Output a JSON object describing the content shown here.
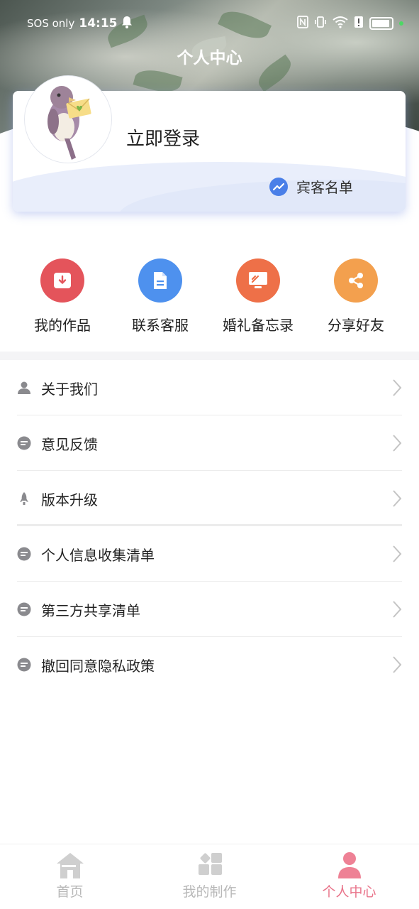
{
  "status_bar": {
    "carrier": "SOS only",
    "time": "14:15"
  },
  "header": {
    "title": "个人中心"
  },
  "profile": {
    "login_text": "立即登录",
    "guest_list_label": "宾客名单"
  },
  "quick_actions": [
    {
      "label": "我的作品",
      "icon": "download-box-icon",
      "color": "#e4545b"
    },
    {
      "label": "联系客服",
      "icon": "document-icon",
      "color": "#4e91ee"
    },
    {
      "label": "婚礼备忘录",
      "icon": "monitor-icon",
      "color": "#ee7048"
    },
    {
      "label": "分享好友",
      "icon": "share-icon",
      "color": "#f3a04e"
    }
  ],
  "menu": [
    {
      "label": "关于我们",
      "icon": "user-icon"
    },
    {
      "label": "意见反馈",
      "icon": "message-icon"
    },
    {
      "label": "版本升级",
      "icon": "rocket-icon"
    },
    {
      "label": "个人信息收集清单",
      "icon": "message-icon"
    },
    {
      "label": "第三方共享清单",
      "icon": "message-icon"
    },
    {
      "label": "撤回同意隐私政策",
      "icon": "message-icon"
    }
  ],
  "tabs": [
    {
      "label": "首页",
      "icon": "home-icon",
      "active": false
    },
    {
      "label": "我的制作",
      "icon": "grid-icon",
      "active": false
    },
    {
      "label": "个人中心",
      "icon": "person-icon",
      "active": true
    }
  ],
  "colors": {
    "accent_pink": "#e9758b",
    "guest_blue": "#4a7fe8",
    "tab_inactive": "#b8b8b8"
  }
}
